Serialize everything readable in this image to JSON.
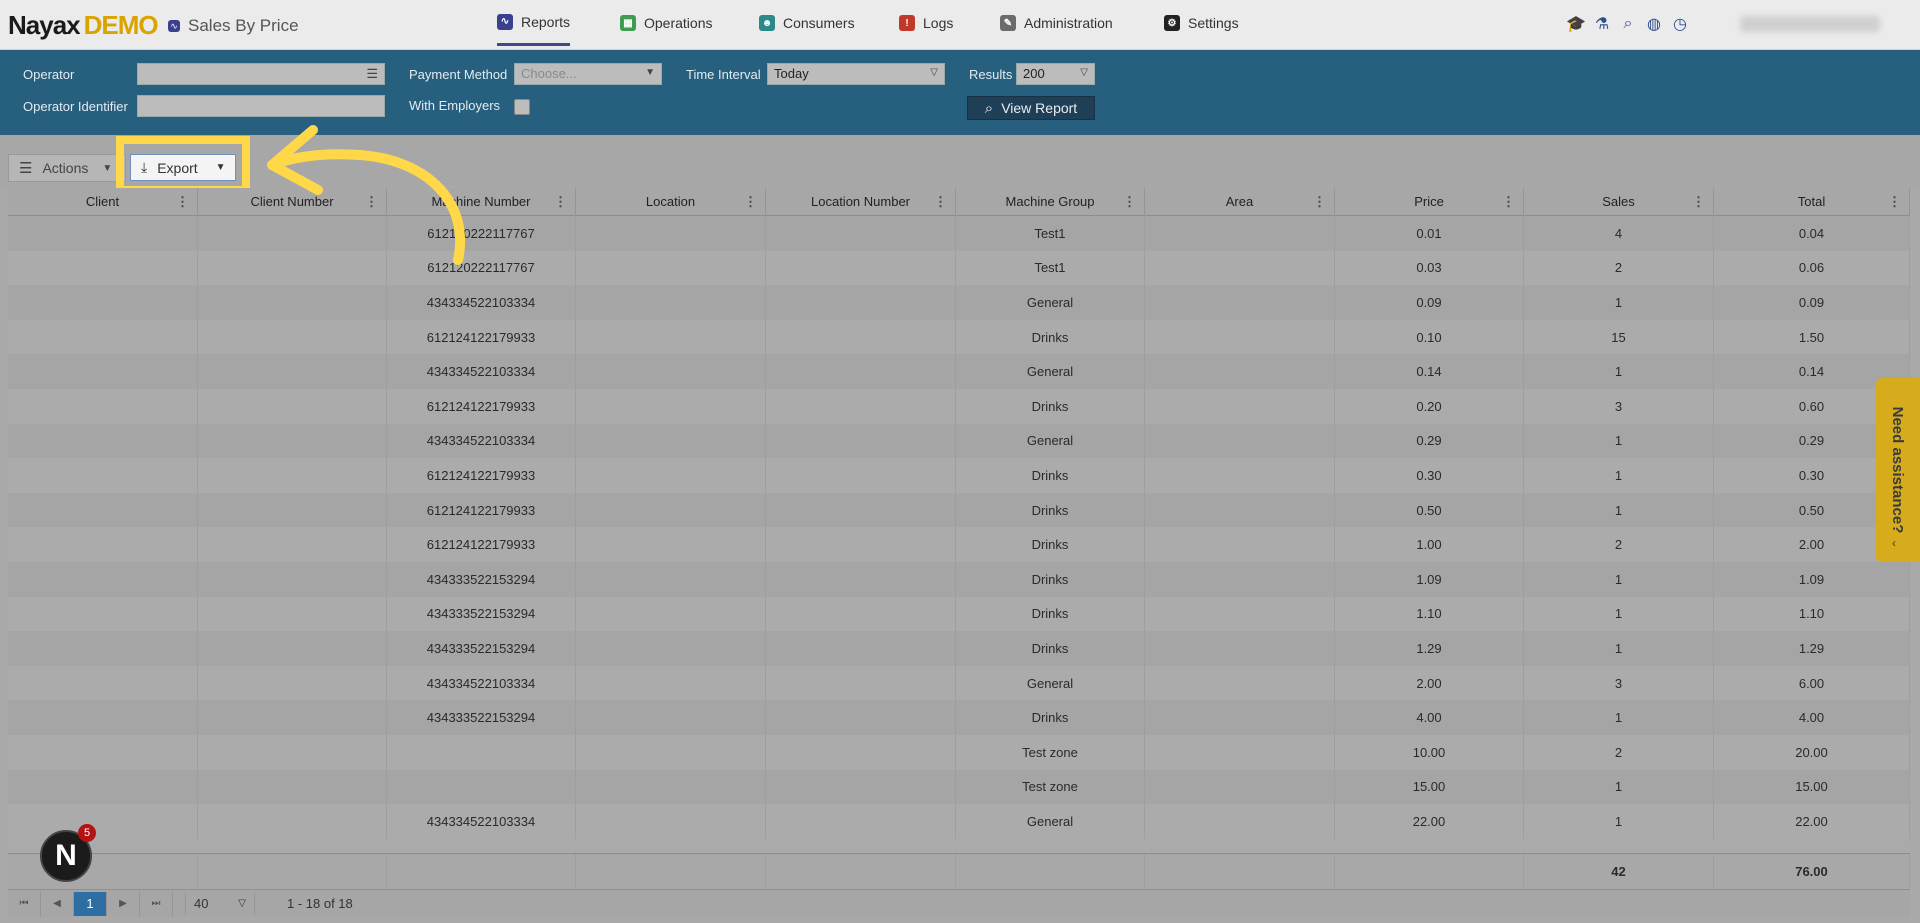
{
  "header": {
    "brand": "Nayax",
    "brand_suffix": "DEMO",
    "page_title": "Sales By Price",
    "nav": [
      {
        "label": "Reports",
        "color": "#3b3f8f",
        "icon": "reports-icon"
      },
      {
        "label": "Operations",
        "color": "#3e9b4f",
        "icon": "operations-icon"
      },
      {
        "label": "Consumers",
        "color": "#2a8a8a",
        "icon": "consumers-icon"
      },
      {
        "label": "Logs",
        "color": "#c0392b",
        "icon": "logs-icon"
      },
      {
        "label": "Administration",
        "color": "#6b6b6b",
        "icon": "administration-icon"
      },
      {
        "label": "Settings",
        "color": "#222222",
        "icon": "settings-icon"
      }
    ]
  },
  "filters": {
    "operator_label": "Operator",
    "operator_identifier_label": "Operator Identifier",
    "payment_method_label": "Payment Method",
    "payment_method_placeholder": "Choose...",
    "with_employers_label": "With Employers",
    "time_interval_label": "Time Interval",
    "time_interval_value": "Today",
    "results_label": "Results",
    "results_value": "200",
    "view_report": "View Report"
  },
  "toolbar": {
    "actions": "Actions",
    "export": "Export"
  },
  "table": {
    "columns": [
      "Client",
      "Client Number",
      "Machine Number",
      "Location",
      "Location Number",
      "Machine Group",
      "Area",
      "Price",
      "Sales",
      "Total"
    ],
    "rows": [
      [
        "",
        "",
        "612120222117767",
        "",
        "",
        "Test1",
        "",
        "0.01",
        "4",
        "0.04"
      ],
      [
        "",
        "",
        "612120222117767",
        "",
        "",
        "Test1",
        "",
        "0.03",
        "2",
        "0.06"
      ],
      [
        "",
        "",
        "434334522103334",
        "",
        "",
        "General",
        "",
        "0.09",
        "1",
        "0.09"
      ],
      [
        "",
        "",
        "612124122179933",
        "",
        "",
        "Drinks",
        "",
        "0.10",
        "15",
        "1.50"
      ],
      [
        "",
        "",
        "434334522103334",
        "",
        "",
        "General",
        "",
        "0.14",
        "1",
        "0.14"
      ],
      [
        "",
        "",
        "612124122179933",
        "",
        "",
        "Drinks",
        "",
        "0.20",
        "3",
        "0.60"
      ],
      [
        "",
        "",
        "434334522103334",
        "",
        "",
        "General",
        "",
        "0.29",
        "1",
        "0.29"
      ],
      [
        "",
        "",
        "612124122179933",
        "",
        "",
        "Drinks",
        "",
        "0.30",
        "1",
        "0.30"
      ],
      [
        "",
        "",
        "612124122179933",
        "",
        "",
        "Drinks",
        "",
        "0.50",
        "1",
        "0.50"
      ],
      [
        "",
        "",
        "612124122179933",
        "",
        "",
        "Drinks",
        "",
        "1.00",
        "2",
        "2.00"
      ],
      [
        "",
        "",
        "434333522153294",
        "",
        "",
        "Drinks",
        "",
        "1.09",
        "1",
        "1.09"
      ],
      [
        "",
        "",
        "434333522153294",
        "",
        "",
        "Drinks",
        "",
        "1.10",
        "1",
        "1.10"
      ],
      [
        "",
        "",
        "434333522153294",
        "",
        "",
        "Drinks",
        "",
        "1.29",
        "1",
        "1.29"
      ],
      [
        "",
        "",
        "434334522103334",
        "",
        "",
        "General",
        "",
        "2.00",
        "3",
        "6.00"
      ],
      [
        "",
        "",
        "434333522153294",
        "",
        "",
        "Drinks",
        "",
        "4.00",
        "1",
        "4.00"
      ],
      [
        "",
        "",
        "",
        "",
        "",
        "Test zone",
        "",
        "10.00",
        "2",
        "20.00"
      ],
      [
        "",
        "",
        "",
        "",
        "",
        "Test zone",
        "",
        "15.00",
        "1",
        "15.00"
      ],
      [
        "",
        "",
        "434334522103334",
        "",
        "",
        "General",
        "",
        "22.00",
        "1",
        "22.00"
      ]
    ],
    "totals": {
      "sales": "42",
      "total": "76.00"
    }
  },
  "pager": {
    "current_page": "1",
    "page_size": "40",
    "range": "1 - 18 of 18"
  },
  "assistance": {
    "label": "Need assistance?"
  },
  "notifications": {
    "logo": "N",
    "count": "5"
  }
}
